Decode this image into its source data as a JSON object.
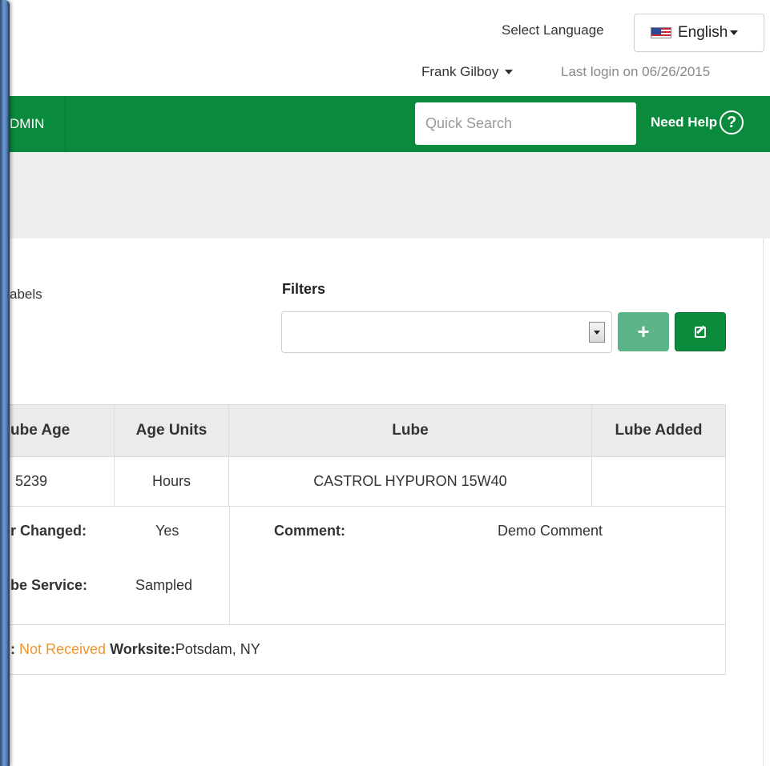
{
  "header": {
    "select_language_label": "Select Language",
    "language": "English",
    "user_name": "Frank Gilboy",
    "last_login": "Last login on 06/26/2015"
  },
  "nav": {
    "item_label": "DMIN",
    "search_placeholder": "Quick Search",
    "help_label": "Need Help",
    "help_icon_glyph": "?"
  },
  "content": {
    "labels_text": "abels",
    "filters_title": "Filters",
    "filter_value": "",
    "add_glyph": "+"
  },
  "table": {
    "headers": {
      "lube_age": "ube Age",
      "age_units": "Age Units",
      "lube": "Lube",
      "lube_added": "Lube Added"
    },
    "row": {
      "lube_age": "5239",
      "age_units": "Hours",
      "lube": "CASTROL HYPURON 15W40",
      "lube_added": ""
    },
    "detail": {
      "changed_label": "r Changed:",
      "changed_value": "Yes",
      "service_label": "be Service:",
      "service_value": "Sampled",
      "comment_label": "Comment:",
      "comment_value": "Demo Comment"
    },
    "status": {
      "prefix": ":",
      "status_value": "Not Received",
      "worksite_label": "Worksite:",
      "worksite_value": "Potsdam, NY"
    }
  },
  "colors": {
    "nav_green": "#0a8a3c",
    "add_button": "#5cb489",
    "status_orange": "#f0952b"
  }
}
